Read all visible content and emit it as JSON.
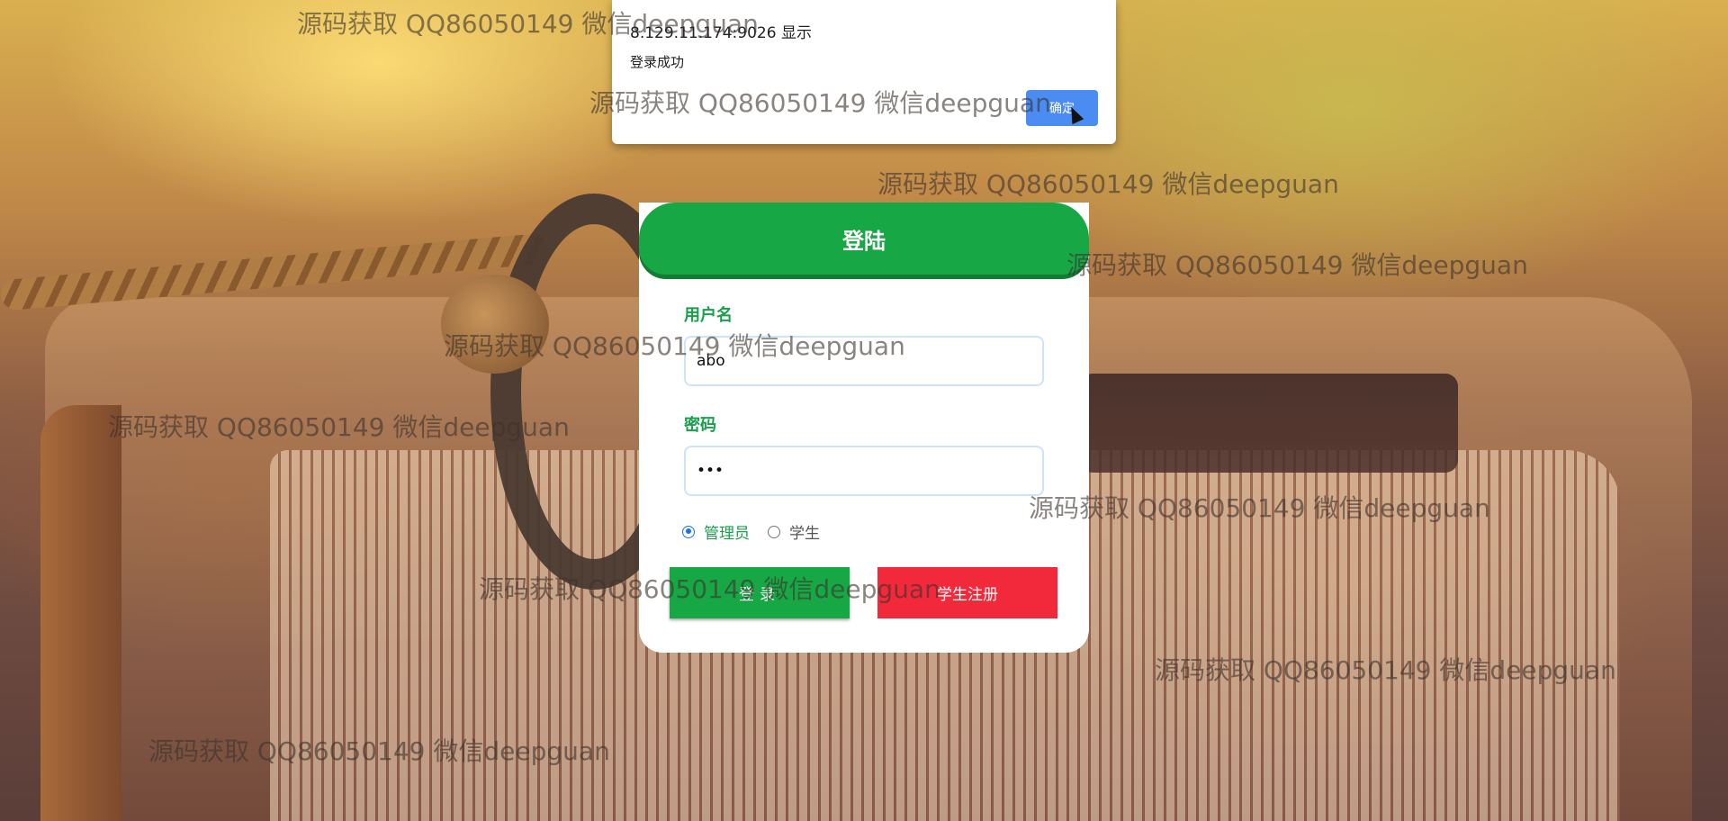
{
  "alert": {
    "title": "8.129.11.174:9026 显示",
    "message": "登录成功",
    "ok_label": "确定"
  },
  "login": {
    "header": "登陆",
    "username_label": "用户名",
    "username_value": "abo",
    "password_label": "密码",
    "password_value": "•••",
    "roles": [
      {
        "label": "管理员",
        "checked": true
      },
      {
        "label": "学生",
        "checked": false
      }
    ],
    "login_button": "登录",
    "register_button": "学生注册"
  },
  "watermark": {
    "text": "源码获取 QQ86050149 微信deepguan"
  },
  "colors": {
    "primary_green": "#18a745",
    "register_red": "#f2283b",
    "dialog_button_blue": "#4a8cf1"
  }
}
